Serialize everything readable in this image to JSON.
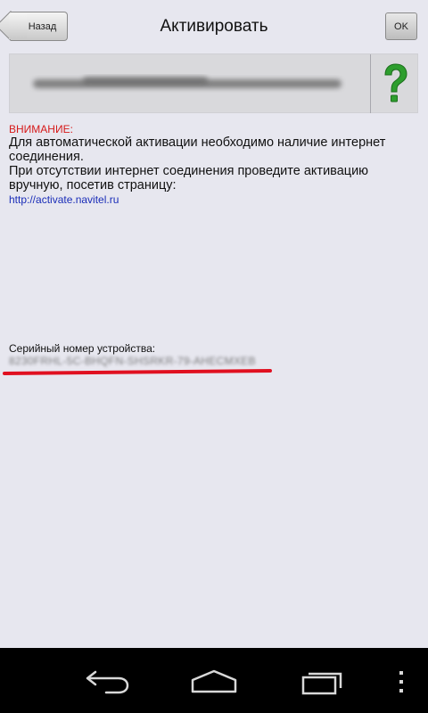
{
  "header": {
    "back_label": "Назад",
    "title": "Активировать",
    "ok_label": "OK"
  },
  "key_box": {
    "help_icon": "question-mark-icon"
  },
  "message": {
    "warning_title": "ВНИМАНИЕ:",
    "line1": "Для автоматической активации необходимо наличие интернет соединения.",
    "line2": "При отсутствии интернет соединения проведите активацию вручную, посетив страницу:",
    "link": "http://activate.navitel.ru"
  },
  "serial": {
    "label": "Серийный номер устройства:",
    "value": "8230FRHL-5C-BHQFN-SHSRKR-79-AHECMXEB"
  },
  "nav": {
    "back_icon": "back-arrow-icon",
    "home_icon": "home-icon",
    "recents_icon": "recent-apps-icon",
    "menu_icon": "overflow-menu-icon"
  },
  "colors": {
    "background": "#e7e7ef",
    "warning": "#d61a1a",
    "link": "#1a2db8",
    "underline": "#e01020",
    "help_icon": "#2e9e2e"
  }
}
